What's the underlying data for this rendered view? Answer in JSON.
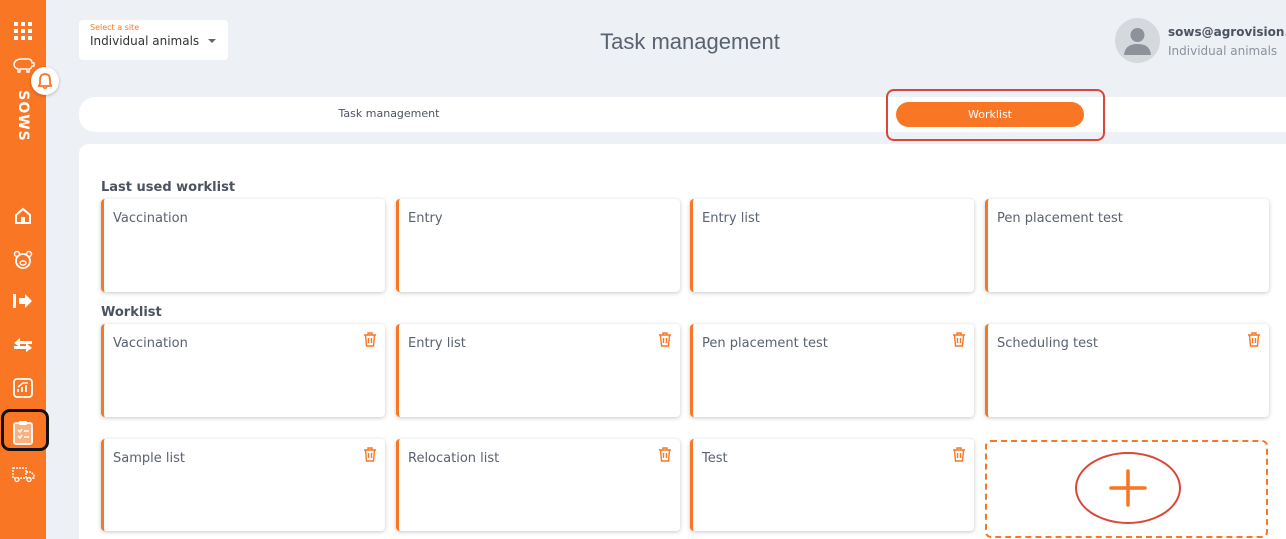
{
  "sidebar": {
    "brand": "SOWS",
    "items": [
      {
        "icon": "apps-grid-icon"
      },
      {
        "icon": "pig-icon"
      },
      {
        "icon": "home-icon"
      },
      {
        "icon": "animal-face-icon"
      },
      {
        "icon": "arrow-right-icon"
      },
      {
        "icon": "transfer-arrows-icon"
      },
      {
        "icon": "analytics-icon"
      },
      {
        "icon": "clipboard-tasks-icon",
        "active": true
      },
      {
        "icon": "truck-icon"
      }
    ]
  },
  "header": {
    "site_label": "Select a site",
    "site_value": "Individual animals",
    "title": "Task management",
    "user_email": "sows@agrovision.com",
    "user_site": "Individual animals"
  },
  "tabs": [
    {
      "label": "Task management",
      "active": false
    },
    {
      "label": "Worklist",
      "active": true
    }
  ],
  "last_used": {
    "title": "Last used worklist",
    "items": [
      "Vaccination",
      "Entry",
      "Entry list",
      "Pen placement test"
    ]
  },
  "worklist": {
    "title": "Worklist",
    "items": [
      "Vaccination",
      "Entry list",
      "Pen placement test",
      "Scheduling test",
      "Sample list",
      "Relocation list",
      "Test"
    ]
  },
  "colors": {
    "accent": "#f97624",
    "highlight": "#d9473a"
  }
}
